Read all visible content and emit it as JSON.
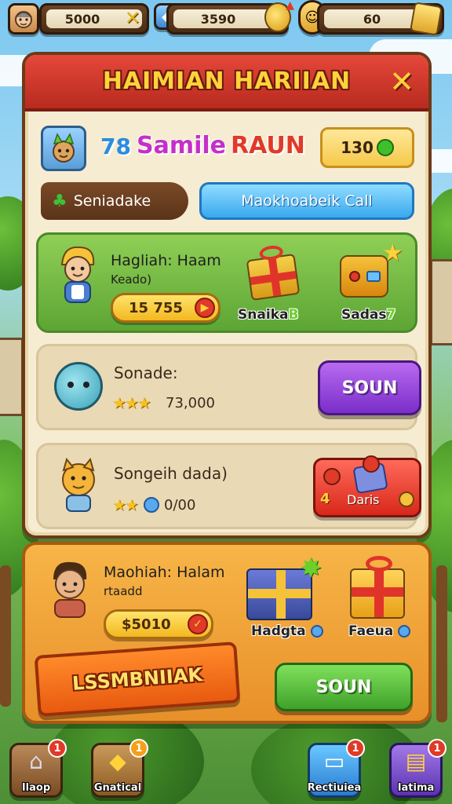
{
  "resources": {
    "coins": {
      "value": "5000",
      "action_icon": "close-x-icon"
    },
    "gems": {
      "value": "3590"
    },
    "tickets": {
      "value": "60"
    }
  },
  "panel": {
    "title": "HAIMIAN HARIIAN",
    "player": {
      "level": "78",
      "name": "Samile",
      "name2": "RAUN",
      "score": "130"
    },
    "tabs": [
      {
        "label": "Seniadake",
        "icon": "clover-icon"
      },
      {
        "label": "Maokhoabeik Call"
      }
    ],
    "featured": {
      "title": "Hagliah: Haam",
      "subtitle": "Keado)",
      "price": "15 755",
      "items": [
        {
          "label": "Snaika",
          "suffix": "B"
        },
        {
          "label": "Sadas",
          "suffix": "7"
        }
      ]
    },
    "rows": [
      {
        "title": "Sonade:",
        "value": "73,000",
        "stars": "★★★",
        "button": "SOUN"
      },
      {
        "title": "Songeih dada)",
        "value": "0/00",
        "stars": "★★",
        "button_count": "4",
        "button_label": "Daris"
      }
    ]
  },
  "offer": {
    "title": "Maohiah: Halam",
    "subtitle": "rtaadd",
    "price": "$5010",
    "items": [
      {
        "label": "Hadgta"
      },
      {
        "label": "Faeua"
      }
    ],
    "ribbon": "LSSMBNIIAK",
    "button": "SOUN"
  },
  "nav": [
    {
      "label": "Ilaop",
      "badge": "1",
      "icon": "house-icon"
    },
    {
      "label": "Gnatical",
      "badge": "1",
      "icon": "gem-bag-icon"
    },
    {
      "label": "Rectiuiea",
      "badge": "1",
      "icon": "computer-icon"
    },
    {
      "label": "Iatima",
      "badge": "1",
      "icon": "laptop-icon"
    }
  ],
  "colors": {
    "header_red": "#c8342a",
    "title_gold": "#ffd23a",
    "panel_cream": "#f6ecd2",
    "purple_button": "#8e3ed6",
    "green_button": "#4fb532",
    "ribbon_orange": "#f06a18"
  }
}
